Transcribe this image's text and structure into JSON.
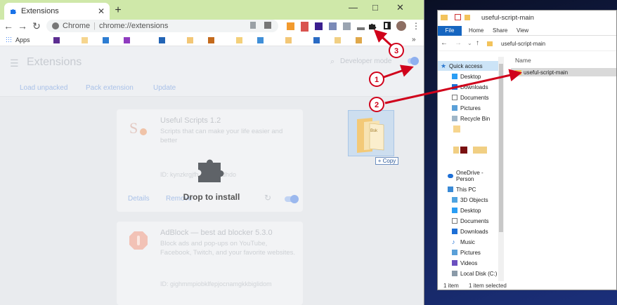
{
  "chrome": {
    "tab_title": "Extensions",
    "omnibox_prefix": "Chrome",
    "url": "chrome://extensions",
    "bookmarks_label": "Apps",
    "bookmarks_overflow": "»",
    "window_controls": [
      "—",
      "□",
      "✕"
    ]
  },
  "extensions_page": {
    "title": "Extensions",
    "dev_mode_label": "Developer mode",
    "actions": [
      "Load unpacked",
      "Pack extension",
      "Update"
    ],
    "cards": [
      {
        "name": "Useful Scripts 1.2",
        "description": "Scripts that can make your life easier and better",
        "id": "ID: kynzkrgjfh...jaelkmdhdo",
        "remove_label": "Remove",
        "details_label": "Details"
      },
      {
        "name": "AdBlock — best ad blocker 5.3.0",
        "description": "Block ads and pop-ups on YouTube, Facebook, Twitch, and your favorite websites.",
        "id": "ID: gighmmpiobklfepjocnamgkkbiglidom"
      }
    ],
    "drop_text": "Drop to install"
  },
  "drag": {
    "copy_label": "+ Copy",
    "ghost_label": "Bsk"
  },
  "annotations": [
    "1",
    "2",
    "3"
  ],
  "explorer": {
    "title": "useful-script-main",
    "ribbon_tabs": [
      "File",
      "Home",
      "Share",
      "View"
    ],
    "address": "useful-script-main",
    "column_header": "Name",
    "selected_row": "useful-script-main",
    "nav_items": [
      {
        "label": "Quick access",
        "icon": "star-icon"
      },
      {
        "label": "Desktop",
        "icon": "desktop-icon"
      },
      {
        "label": "Downloads",
        "icon": "download-icon"
      },
      {
        "label": "Documents",
        "icon": "document-icon"
      },
      {
        "label": "Pictures",
        "icon": "picture-icon"
      },
      {
        "label": "Recycle Bin",
        "icon": "recycle-bin-icon"
      },
      {
        "label": "OneDrive - Person",
        "icon": "cloud-icon"
      },
      {
        "label": "This PC",
        "icon": "computer-icon"
      },
      {
        "label": "3D Objects",
        "icon": "cube-icon"
      },
      {
        "label": "Desktop",
        "icon": "desktop-icon"
      },
      {
        "label": "Documents",
        "icon": "document-icon"
      },
      {
        "label": "Downloads",
        "icon": "download-icon"
      },
      {
        "label": "Music",
        "icon": "music-icon"
      },
      {
        "label": "Pictures",
        "icon": "picture-icon"
      },
      {
        "label": "Videos",
        "icon": "video-icon"
      },
      {
        "label": "Local Disk (C:)",
        "icon": "disk-icon"
      }
    ],
    "status_count": "1 item",
    "status_selected": "1 item selected"
  },
  "colors": {
    "tabstrip": "#cfe8a9",
    "annotation_red": "#d0021b",
    "explorer_blue": "#1565c0"
  }
}
